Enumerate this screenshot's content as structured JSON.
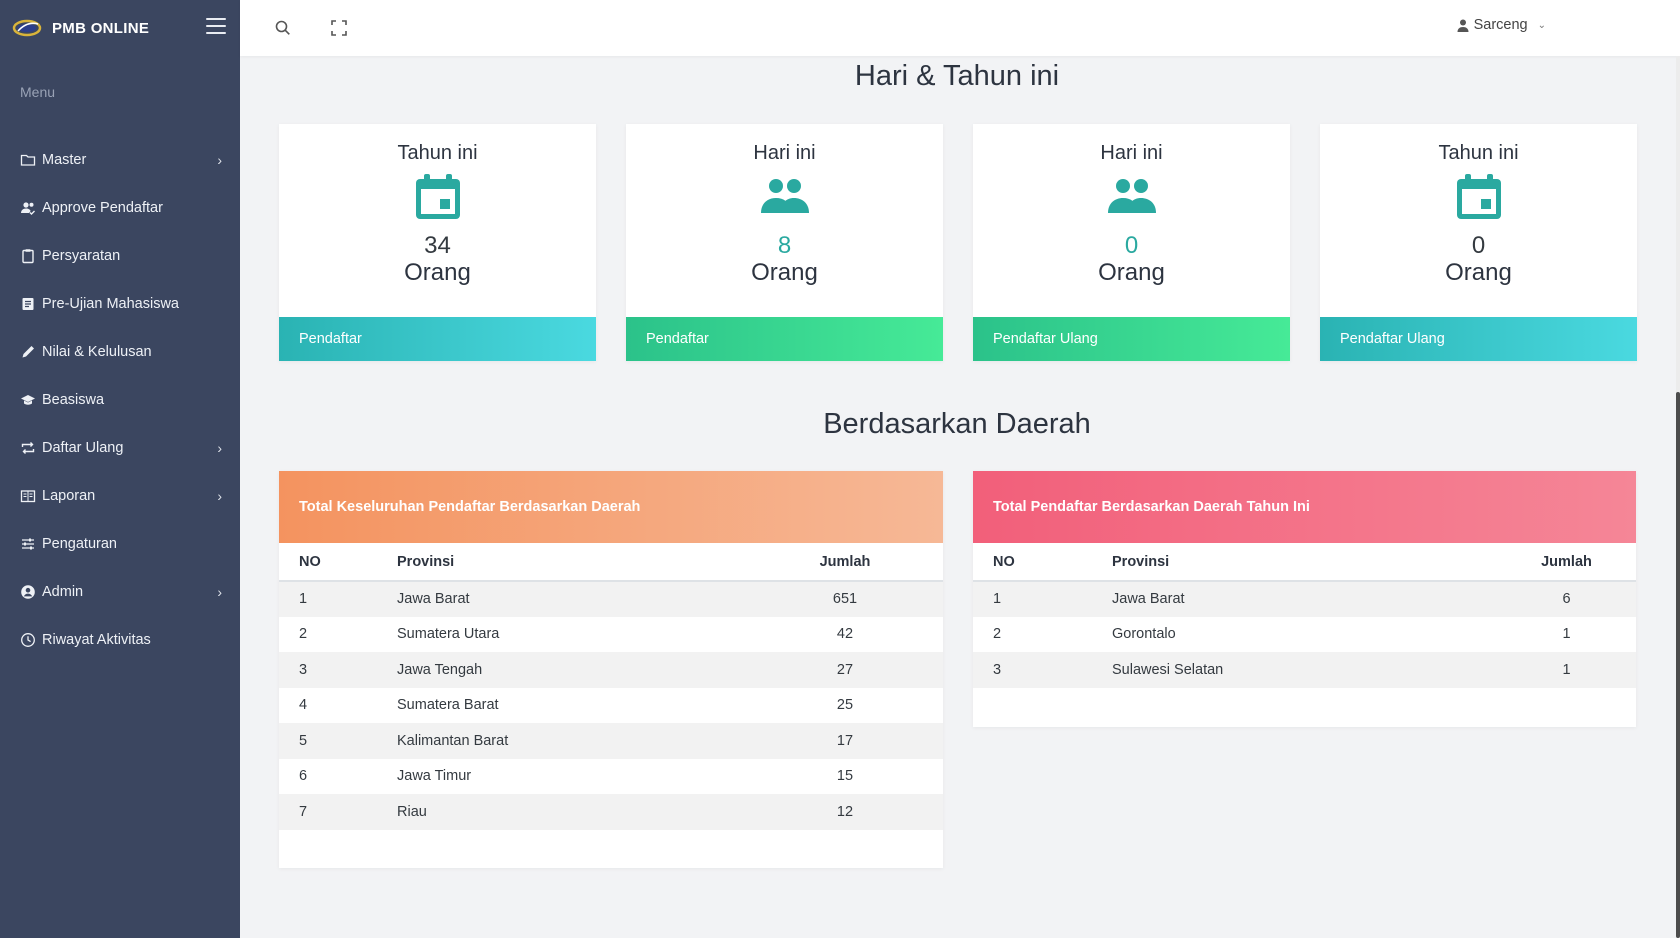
{
  "app": {
    "title": "PMB ONLINE"
  },
  "sidebar": {
    "menu_title": "Menu",
    "items": [
      {
        "label": "Master",
        "icon": "folder-icon",
        "has_children": true
      },
      {
        "label": "Approve Pendaftar",
        "icon": "users-check-icon",
        "has_children": false
      },
      {
        "label": "Persyaratan",
        "icon": "clipboard-icon",
        "has_children": false
      },
      {
        "label": "Pre-Ujian Mahasiswa",
        "icon": "document-list-icon",
        "has_children": false
      },
      {
        "label": "Nilai & Kelulusan",
        "icon": "pencil-icon",
        "has_children": false
      },
      {
        "label": "Beasiswa",
        "icon": "graduation-cap-icon",
        "has_children": false
      },
      {
        "label": "Daftar Ulang",
        "icon": "repeat-icon",
        "has_children": true
      },
      {
        "label": "Laporan",
        "icon": "book-icon",
        "has_children": true
      },
      {
        "label": "Pengaturan",
        "icon": "sliders-icon",
        "has_children": false
      },
      {
        "label": "Admin",
        "icon": "user-circle-icon",
        "has_children": true
      },
      {
        "label": "Riwayat Aktivitas",
        "icon": "clock-icon",
        "has_children": false
      }
    ]
  },
  "topbar": {
    "user_name": "Sarceng"
  },
  "sections": {
    "today_year": "Hari & Tahun ini",
    "by_region": "Berdasarkan Daerah"
  },
  "stats": [
    {
      "heading": "Tahun ini",
      "icon": "calendar-icon",
      "value": "34",
      "value_color": "#343a40",
      "unit": "Orang",
      "footer": "Pendaftar",
      "footer_gradient": [
        "#2ab3b3",
        "#4ad9e0"
      ]
    },
    {
      "heading": "Hari ini",
      "icon": "users-icon",
      "value": "8",
      "value_color": "#2aa9a0",
      "unit": "Orang",
      "footer": "Pendaftar",
      "footer_gradient": [
        "#2bc28a",
        "#46ea97"
      ]
    },
    {
      "heading": "Hari ini",
      "icon": "users-icon",
      "value": "0",
      "value_color": "#2aa9a0",
      "unit": "Orang",
      "footer": "Pendaftar Ulang",
      "footer_gradient": [
        "#2bc28a",
        "#46ea97"
      ]
    },
    {
      "heading": "Tahun ini",
      "icon": "calendar-icon",
      "value": "0",
      "value_color": "#343a40",
      "unit": "Orang",
      "footer": "Pendaftar Ulang",
      "footer_gradient": [
        "#2ab3b3",
        "#4ad9e0"
      ]
    }
  ],
  "colors": {
    "accent_teal": "#2aa9a0",
    "sidebar_bg": "#3b4660"
  },
  "tables": [
    {
      "title": "Total Keseluruhan Pendaftar Berdasarkan Daerah",
      "header_gradient": [
        "#f4935f",
        "#f6b896"
      ],
      "columns": [
        "NO",
        "Provinsi",
        "Jumlah"
      ],
      "rows": [
        [
          "1",
          "Jawa Barat",
          "651"
        ],
        [
          "2",
          "Sumatera Utara",
          "42"
        ],
        [
          "3",
          "Jawa Tengah",
          "27"
        ],
        [
          "4",
          "Sumatera Barat",
          "25"
        ],
        [
          "5",
          "Kalimantan Barat",
          "17"
        ],
        [
          "6",
          "Jawa Timur",
          "15"
        ],
        [
          "7",
          "Riau",
          "12"
        ]
      ]
    },
    {
      "title": "Total Pendaftar Berdasarkan Daerah Tahun Ini",
      "header_gradient": [
        "#f25f7a",
        "#f58697"
      ],
      "columns": [
        "NO",
        "Provinsi",
        "Jumlah"
      ],
      "rows": [
        [
          "1",
          "Jawa Barat",
          "6"
        ],
        [
          "2",
          "Gorontalo",
          "1"
        ],
        [
          "3",
          "Sulawesi Selatan",
          "1"
        ]
      ]
    }
  ]
}
